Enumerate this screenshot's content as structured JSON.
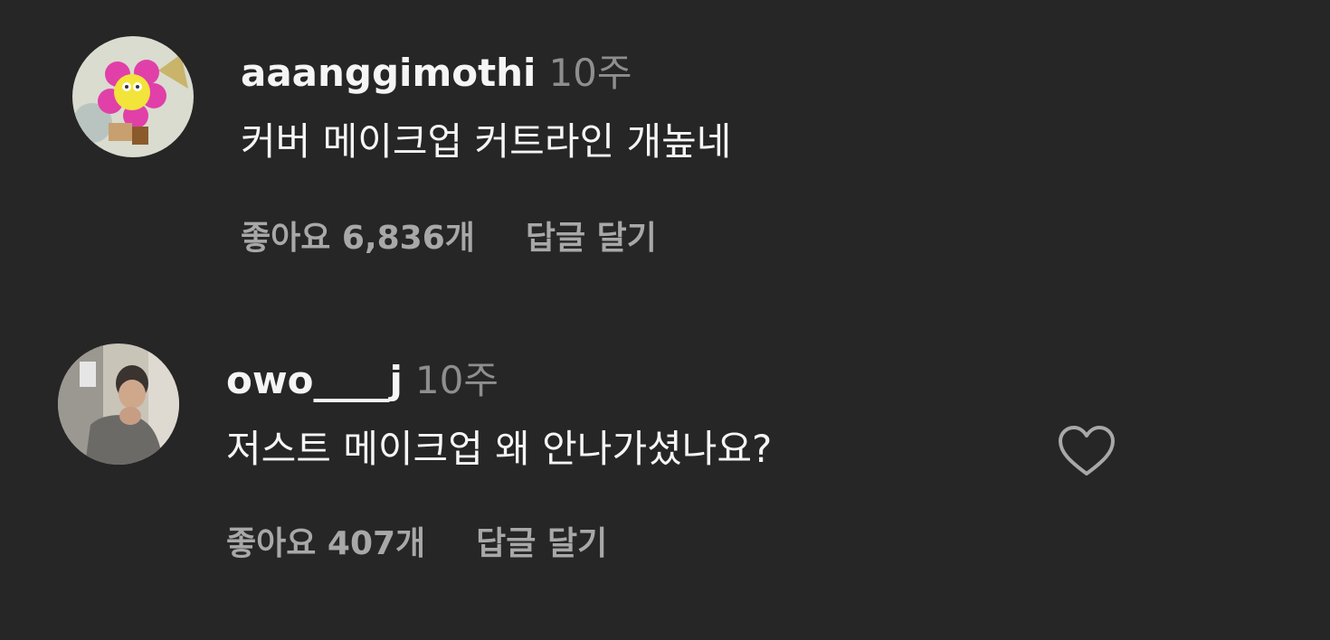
{
  "comments": [
    {
      "username": "aaanggimothi",
      "time": "10주",
      "text": "커버 메이크업 커트라인 개높네",
      "likes": "좋아요 6,836개",
      "reply": "답글 달기"
    },
    {
      "username": "owo____j",
      "time": "10주",
      "text": "저스트 메이크업 왜 안나가셨나요?",
      "likes": "좋아요 407개",
      "reply": "답글 달기"
    }
  ],
  "icons": {
    "like": "heart-outline-icon"
  },
  "colors": {
    "background": "#262626",
    "primary_text": "#f5f5f5",
    "secondary_text": "#8e8e8e",
    "action_text": "#a8a8a8"
  }
}
